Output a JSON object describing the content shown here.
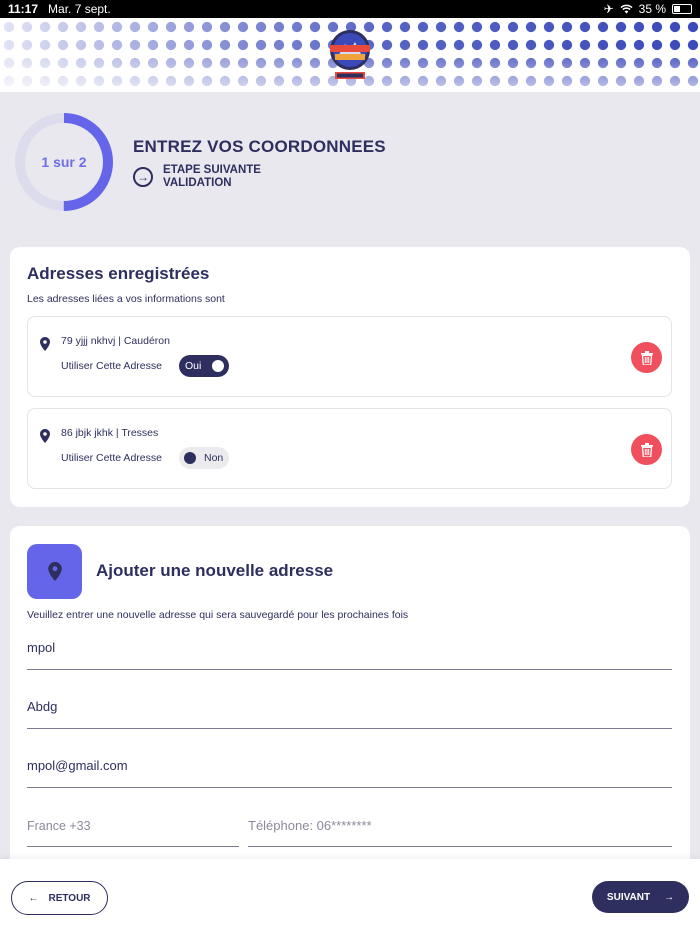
{
  "status_bar": {
    "time": "11:17",
    "date": "Mar. 7 sept.",
    "battery": "35 %",
    "icons": [
      "airplane-icon",
      "wifi-icon",
      "battery-icon"
    ]
  },
  "brand": {
    "logo_alt": "D'STREET TACOS HALAL",
    "colors": {
      "primary": "#2e2f5e",
      "accent": "#6565ea",
      "danger": "#f0505d"
    }
  },
  "progress": {
    "label": "1 sur 2",
    "fraction": 0.5
  },
  "step": {
    "title": "ENTREZ VOS COORDONNEES",
    "next_label_1": "ETAPE SUIVANTE",
    "next_label_2": "VALIDATION"
  },
  "saved_addresses": {
    "title": "Adresses enregistrées",
    "subtitle": "Les adresses liées a vos informations sont",
    "items": [
      {
        "address": "79 yjjj nkhvj | Caudéron",
        "use_label": "Utiliser Cette Adresse",
        "toggle_label": "Oui",
        "selected": true
      },
      {
        "address": "86 jbjk jkhk | Tresses",
        "use_label": "Utiliser Cette Adresse",
        "toggle_label": "Non",
        "selected": false
      }
    ]
  },
  "new_address": {
    "title": "Ajouter une nouvelle adresse",
    "subtitle": "Veuillez entrer une nouvelle adresse qui sera sauvegardé pour les prochaines fois",
    "fields": {
      "first_name": "mpol",
      "last_name": "Abdg",
      "email": "mpol@gmail.com",
      "country_code": "France +33",
      "phone": "Téléphone: 06********"
    }
  },
  "footer": {
    "back_label": "RETOUR",
    "next_label": "SUIVANT"
  }
}
